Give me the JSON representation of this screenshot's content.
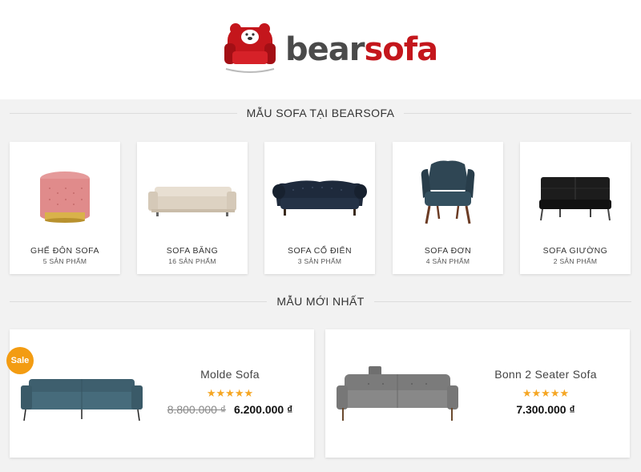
{
  "brand": {
    "part1": "bear",
    "part2": "sofa",
    "colors": {
      "dark": "#4a4a4a",
      "red": "#c4161c"
    }
  },
  "sections": {
    "categories_title": "MẪU SOFA TẠI BEARSOFA",
    "newest_title": "MẪU MỚI NHẤT"
  },
  "categories": [
    {
      "name": "GHẾ ĐÔN SOFA",
      "count": "5 SẢN PHẨM",
      "icon": "pink-ottoman-image"
    },
    {
      "name": "SOFA BĂNG",
      "count": "16 SẢN PHẨM",
      "icon": "beige-sofa-image"
    },
    {
      "name": "SOFA CỔ ĐIỂN",
      "count": "3 SẢN PHẨM",
      "icon": "chesterfield-sofa-image"
    },
    {
      "name": "SOFA ĐƠN",
      "count": "4 SẢN PHẨM",
      "icon": "wingback-chair-image"
    },
    {
      "name": "SOFA GIƯỜNG",
      "count": "2 SẢN PHẨM",
      "icon": "black-sofa-bed-image"
    }
  ],
  "products": [
    {
      "name": "Molde Sofa",
      "badge": "Sale",
      "rating": 5,
      "stars": "★★★★★",
      "old_price": "8.800.000 ₫",
      "price": "6.200.000 ₫",
      "icon": "teal-sofa-image"
    },
    {
      "name": "Bonn 2 Seater Sofa",
      "rating": 5,
      "stars": "★★★★★",
      "price": "7.300.000 ₫",
      "icon": "grey-sofa-image"
    }
  ],
  "colors": {
    "accent_star": "#f5a623",
    "sale_badge": "#f39c12"
  }
}
